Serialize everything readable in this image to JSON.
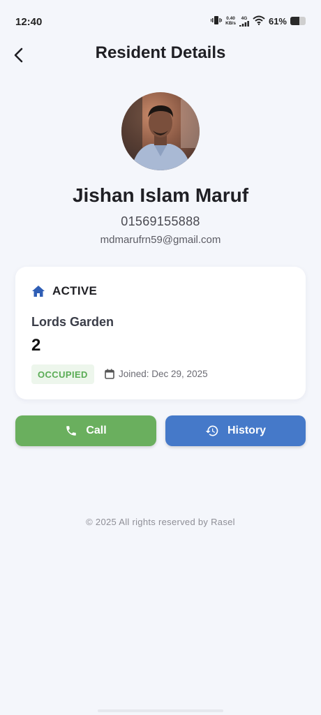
{
  "status_bar": {
    "time": "12:40",
    "net_speed_value": "0.40",
    "net_speed_unit": "KB/s",
    "network_type": "4G",
    "battery_percent": "61%",
    "battery_level": 0.61
  },
  "header": {
    "title": "Resident Details"
  },
  "resident": {
    "name": "Jishan Islam Maruf",
    "phone": "01569155888",
    "email": "mdmarufrn59@gmail.com"
  },
  "card": {
    "status": "ACTIVE",
    "building": "Lords Garden",
    "unit": "2",
    "occupancy": "OCCUPIED",
    "joined": "Joined: Dec 29, 2025"
  },
  "actions": {
    "call_label": "Call",
    "history_label": "History"
  },
  "footer": {
    "text": "© 2025 All rights reserved by Rasel"
  },
  "colors": {
    "call": "#6aaf5e",
    "history": "#4579c9",
    "status_icon": "#2f5eb5",
    "occupied_text": "#5aac55",
    "background": "#f4f6fb"
  }
}
